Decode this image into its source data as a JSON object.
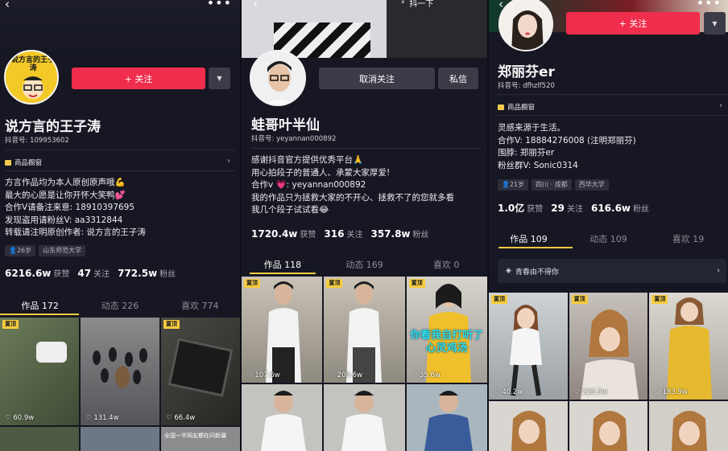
{
  "colors": {
    "bg": "#161722",
    "accent_red": "#f02d4c",
    "pin_yellow": "#f6cc3d",
    "caption_cyan": "#2de3f0"
  },
  "icons": {
    "back": "back-arrow-icon",
    "more": "more-dots-icon",
    "share": "share-icon",
    "heart": "heart-icon",
    "shop": "shop-icon",
    "collection": "collection-icon"
  },
  "panel1": {
    "avatar_text": "说方言的王子涛",
    "follow_label": "+ 关注",
    "name": "说方言的王子涛",
    "uid": "抖音号: 109953602",
    "shop_label": "商品橱窗",
    "bio": [
      "方言作品均为本人原创原声哦💪",
      "最大的心愿是让你开怀大笑鸭💕",
      "合作V请备注来意: 18910397695",
      "发现盗用请粉丝V: aa3312844",
      "转载请注明原创作者: 说方言的王子涛"
    ],
    "tags": [
      "👤26岁",
      "山东师范大学"
    ],
    "stats": [
      {
        "value": "6216.6w",
        "label": "获赞"
      },
      {
        "value": "47",
        "label": "关注"
      },
      {
        "value": "772.5w",
        "label": "粉丝"
      }
    ],
    "tabs": [
      "作品 172",
      "动态 226",
      "喜欢 774"
    ],
    "pin_label": "置顶",
    "videos": [
      {
        "likes": "60.9w"
      },
      {
        "likes": "131.4w"
      },
      {
        "likes": "66.4w"
      }
    ],
    "bottom_caption": "全国一半网友都在问新疆"
  },
  "panel2": {
    "share_label": "抖一下",
    "unfollow_label": "取消关注",
    "message_label": "私信",
    "name": "蛙哥叶半仙",
    "uid": "抖音号: yeyannan000892",
    "bio": [
      "感谢抖音官方提供优秀平台🙏",
      "用心拍段子的普通人、承蒙大家厚爱!",
      "合作v 💗: yeyannan000892",
      "我的作品只为拯救大家的不开心、拯救不了的您就多看",
      "我几个段子试试看😂"
    ],
    "stats": [
      {
        "value": "1720.4w",
        "label": "获赞"
      },
      {
        "value": "316",
        "label": "关注"
      },
      {
        "value": "357.8w",
        "label": "粉丝"
      }
    ],
    "tabs": [
      "作品 118",
      "动态 169",
      "喜欢 0"
    ],
    "pin_label": "置顶",
    "videos": [
      {
        "likes": "107.6w"
      },
      {
        "likes": "209.6w"
      },
      {
        "likes": "35.6w",
        "caption": "你看我自打听了心灵鸡汤"
      }
    ]
  },
  "panel3": {
    "follow_label": "+ 关注",
    "name": "郑丽芬er",
    "uid": "抖音号: dfhzlf520",
    "shop_label": "商品橱窗",
    "bio": [
      "灵感来源于生活。",
      "合作V: 18884276008 (注明郑丽芬)",
      "围脖: 郑丽芬er",
      "粉丝群V: Sonic0314"
    ],
    "tags": [
      "👤21岁",
      "四川 · 成都",
      "西华大学"
    ],
    "stats": [
      {
        "value": "1.0亿",
        "label": "获赞"
      },
      {
        "value": "29",
        "label": "关注"
      },
      {
        "value": "616.6w",
        "label": "粉丝"
      }
    ],
    "tabs": [
      "作品 109",
      "动态 109",
      "喜欢 19"
    ],
    "collection_label": "青春由不得你",
    "pin_label": "置顶",
    "videos": [
      {
        "likes": "40.2w"
      },
      {
        "likes": "226.5w"
      },
      {
        "likes": "183.9w"
      }
    ]
  }
}
